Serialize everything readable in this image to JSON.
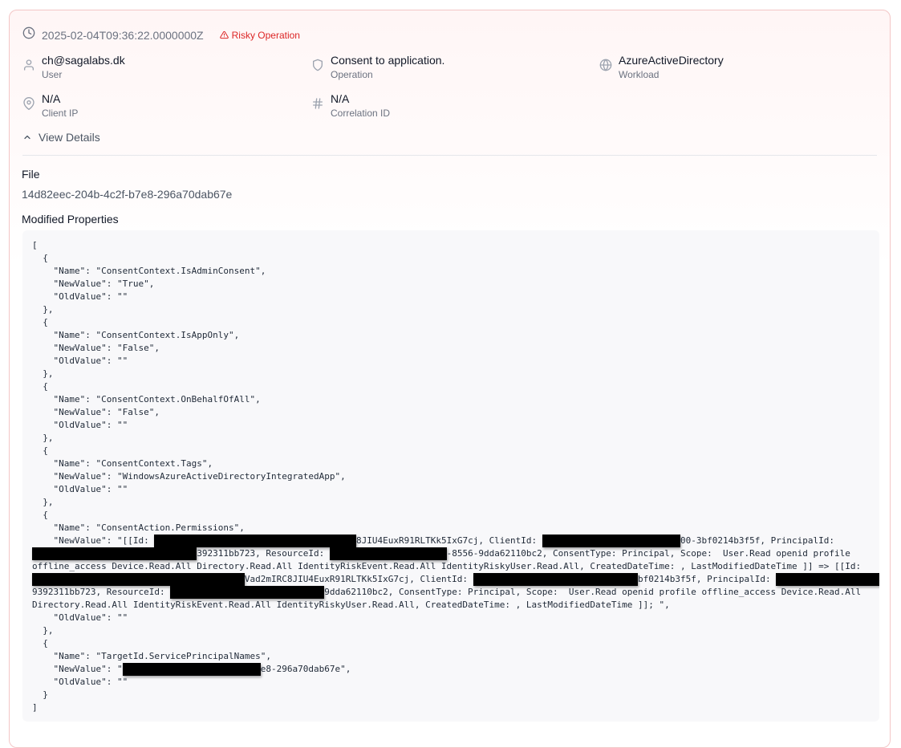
{
  "event": {
    "timestamp": "2025-02-04T09:36:22.0000000Z",
    "risk_badge": "Risky Operation",
    "accent_color": "#dc2626"
  },
  "fields": {
    "user": {
      "value": "ch@sagalabs.dk",
      "label": "User"
    },
    "operation": {
      "value": "Consent to application.",
      "label": "Operation"
    },
    "workload": {
      "value": "AzureActiveDirectory",
      "label": "Workload"
    },
    "client_ip": {
      "value": "N/A",
      "label": "Client IP"
    },
    "correlation_id": {
      "value": "N/A",
      "label": "Correlation ID"
    }
  },
  "details": {
    "toggle_label": "View Details",
    "file_heading": "File",
    "file_value": "14d82eec-204b-4c2f-b7e8-296a70dab67e",
    "props_heading": "Modified Properties",
    "json_lines": [
      "[",
      "  {",
      "    \"Name\": \"ConsentContext.IsAdminConsent\",",
      "    \"NewValue\": \"True\",",
      "    \"OldValue\": \"\"",
      "  },",
      "  {",
      "    \"Name\": \"ConsentContext.IsAppOnly\",",
      "    \"NewValue\": \"False\",",
      "    \"OldValue\": \"\"",
      "  },",
      "  {",
      "    \"Name\": \"ConsentContext.OnBehalfOfAll\",",
      "    \"NewValue\": \"False\",",
      "    \"OldValue\": \"\"",
      "  },",
      "  {",
      "    \"Name\": \"ConsentContext.Tags\",",
      "    \"NewValue\": \"WindowsAzureActiveDirectoryIntegratedApp\",",
      "    \"OldValue\": \"\"",
      "  },",
      "  {",
      "    \"Name\": \"ConsentAction.Permissions\",",
      "    \"NewValue\": \"[[Id: ▮38▮8JIU4EuxR91RLTKk5IxG7cj, ClientId: ▮26▮00-3bf0214b3f5f, PrincipalId:",
      "▮31▮392311bb723, ResourceId: ▮22▮-8556-9dda62110bc2, ConsentType: Principal, Scope:  User.Read openid profile",
      "offline_access Device.Read.All Directory.Read.All IdentityRiskEvent.Read.All IdentityRiskyUser.Read.All, CreatedDateTime: , LastModifiedDateTime ]] => [[Id:",
      "▮40▮Vad2mIRC8JIU4EuxR91RLTKk5IxG7cj, ClientId: ▮31▮bf0214b3f5f, PrincipalId: ▮30▮",
      "9392311bb723, ResourceId: ▮29▮9dda62110bc2, ConsentType: Principal, Scope:  User.Read openid profile offline_access Device.Read.All",
      "Directory.Read.All IdentityRiskEvent.Read.All IdentityRiskyUser.Read.All, CreatedDateTime: , LastModifiedDateTime ]]; \",",
      "    \"OldValue\": \"\"",
      "  },",
      "  {",
      "    \"Name\": \"TargetId.ServicePrincipalNames\",",
      "    \"NewValue\": \"▮26▮e8-296a70dab67e\",",
      "    \"OldValue\": \"\"",
      "  }",
      "]"
    ]
  },
  "icons": [
    "clock-icon",
    "warning-triangle-icon",
    "user-icon",
    "shield-icon",
    "globe-icon",
    "map-pin-icon",
    "hash-icon",
    "chevron-up-icon"
  ]
}
